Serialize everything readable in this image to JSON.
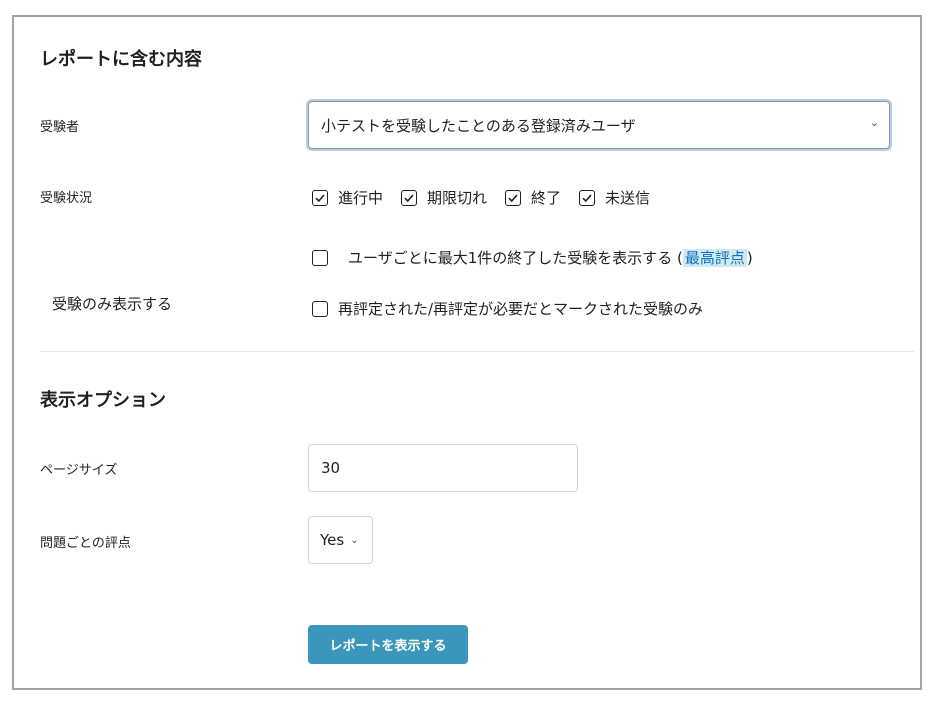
{
  "section1": {
    "title": "レポートに含む内容",
    "attempts_from": {
      "label": "受験者",
      "selected": "小テストを受験したことのある登録済みユーザ",
      "chevron_icon": "chevron-down-icon"
    },
    "attempt_state": {
      "label": "受験状況",
      "options": [
        {
          "label": "進行中",
          "checked": true
        },
        {
          "label": "期限切れ",
          "checked": true
        },
        {
          "label": "終了",
          "checked": true
        },
        {
          "label": "未送信",
          "checked": true
        }
      ]
    },
    "show_only": {
      "label": "受験のみ表示する",
      "option1_prefix": "ユーザごとに最大1件の終了した受験を表示する (",
      "option1_link": "最高評点",
      "option1_suffix": ")",
      "option1_checked": false,
      "option2": "再評定された/再評定が必要だとマークされた受験のみ",
      "option2_checked": false
    }
  },
  "section2": {
    "title": "表示オプション",
    "page_size": {
      "label": "ページサイズ",
      "value": "30"
    },
    "marks_per_question": {
      "label": "問題ごとの評点",
      "selected": "Yes",
      "chevron_icon": "chevron-down-icon"
    }
  },
  "submit_button": "レポートを表示する",
  "colors": {
    "button_bg": "#3a97bb",
    "link_highlight": "#cfecf3",
    "focus_ring": "#b8cee7"
  }
}
